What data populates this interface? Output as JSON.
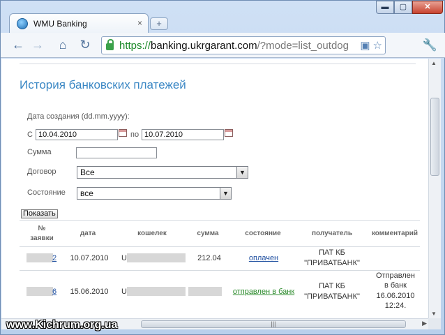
{
  "browser": {
    "tab_title": "WMU Banking",
    "tab_close": "×",
    "new_tab": "+",
    "window_buttons": {
      "minimize": "▬",
      "maximize": "▢",
      "close": "✕"
    },
    "nav": {
      "back": "←",
      "forward": "→",
      "home": "⌂",
      "reload": "↻"
    },
    "url": {
      "scheme": "https://",
      "host": "banking.ukrgarant.com",
      "path": "/?mode=list_outdog"
    },
    "wrench": "🔧"
  },
  "page": {
    "title": "История банковских платежей",
    "form": {
      "date_label": "Дата создания (dd.mm.yyyy):",
      "from_label": "С",
      "date_from": "10.04.2010",
      "to_label": "по",
      "date_to": "10.07.2010",
      "sum_label": "Сумма",
      "sum_value": "",
      "contract_label": "Договор",
      "contract_value": "Все",
      "state_label": "Состояние",
      "state_value": "все",
      "submit_label": "Показать"
    },
    "table": {
      "headers": {
        "number": "№",
        "number2": "заявки",
        "date": "дата",
        "wallet": "кошелек",
        "sum": "сумма",
        "state": "состояние",
        "recipient": "получатель",
        "comment": "комментарий"
      },
      "rows": [
        {
          "number_suffix": "2",
          "date": "10.07.2010",
          "wallet_prefix": "U",
          "sum": "212.04",
          "state": "оплачен",
          "recipient_line1": "ПАТ КБ",
          "recipient_line2": "\"ПРИВАТБАНК\"",
          "comment_lines": []
        },
        {
          "number_suffix": "6",
          "date": "15.06.2010",
          "wallet_prefix": "U",
          "sum": "",
          "state": "отправлен в банк",
          "recipient_line1": "ПАТ КБ",
          "recipient_line2": "\"ПРИВАТБАНК\"",
          "comment_lines": [
            "Отправлен",
            "в банк",
            "16.06.2010",
            "12:24."
          ]
        }
      ]
    }
  },
  "watermark": "www.Kichrum.org.ua",
  "colors": {
    "title": "#3a87c4",
    "link": "#1f4fa0",
    "link_green": "#2a8a2a",
    "https": "#1e8a2b"
  }
}
